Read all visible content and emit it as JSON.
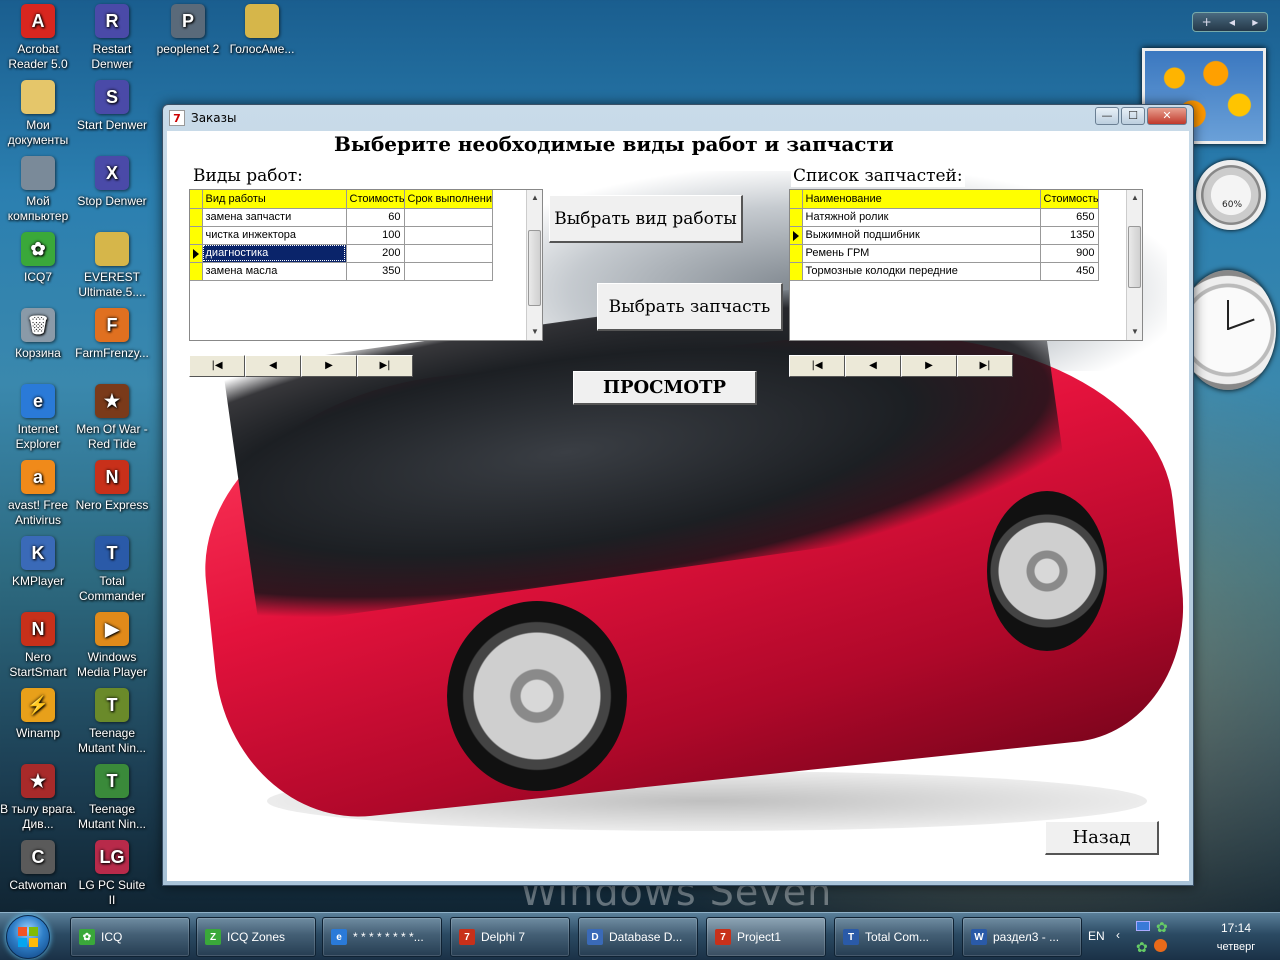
{
  "desktop": {
    "icons": [
      {
        "label": "Acrobat Reader 5.0",
        "color": "#d8261f",
        "glyph": "A"
      },
      {
        "label": "Restart Denwer",
        "color": "#4a4aa8",
        "glyph": "R"
      },
      {
        "label": "peoplenet 2",
        "color": "#5a6a7a",
        "glyph": "P"
      },
      {
        "label": "ГолосАме...",
        "color": "#d6b64a",
        "glyph": ""
      },
      {
        "label": "Мои документы",
        "color": "#e5c66a",
        "glyph": ""
      },
      {
        "label": "Start Denwer",
        "color": "#4a4aa8",
        "glyph": "S"
      },
      {
        "label": "Мой компьютер",
        "color": "#7a8a99",
        "glyph": ""
      },
      {
        "label": "Stop Denwer",
        "color": "#4a4aa8",
        "glyph": "X"
      },
      {
        "label": "ICQ7",
        "color": "#3aa83a",
        "glyph": "✿"
      },
      {
        "label": "EVEREST Ultimate.5....",
        "color": "#d6b64a",
        "glyph": ""
      },
      {
        "label": "Корзина",
        "color": "#8a9aa8",
        "glyph": "🗑"
      },
      {
        "label": "FarmFrenzy...",
        "color": "#e07020",
        "glyph": "F"
      },
      {
        "label": "Internet Explorer",
        "color": "#2a7ad8",
        "glyph": "e"
      },
      {
        "label": "Men Of War - Red Tide",
        "color": "#7a3a1a",
        "glyph": "★"
      },
      {
        "label": "avast! Free Antivirus",
        "color": "#f08a1a",
        "glyph": "a"
      },
      {
        "label": "Nero Express",
        "color": "#c8301a",
        "glyph": "N"
      },
      {
        "label": "KMPlayer",
        "color": "#3a6ab8",
        "glyph": "K"
      },
      {
        "label": "Total Commander",
        "color": "#2a5aa8",
        "glyph": "T"
      },
      {
        "label": "Nero StartSmart",
        "color": "#c8301a",
        "glyph": "N"
      },
      {
        "label": "Windows Media Player",
        "color": "#e08a1a",
        "glyph": "▶"
      },
      {
        "label": "Winamp",
        "color": "#e8a01a",
        "glyph": "⚡"
      },
      {
        "label": "Teenage Mutant Nin...",
        "color": "#6a8a2a",
        "glyph": "T"
      },
      {
        "label": "В тылу врага. Див...",
        "color": "#a82a2a",
        "glyph": "★"
      },
      {
        "label": "Teenage Mutant Nin...",
        "color": "#3a8a3a",
        "glyph": "T"
      },
      {
        "label": "Catwoman",
        "color": "#5a5a5a",
        "glyph": "C"
      },
      {
        "label": "LG PC Suite II",
        "color": "#b82a4a",
        "glyph": "LG"
      }
    ],
    "watermark": "Windows Seven"
  },
  "gadgets": {
    "cpu_label": "60%"
  },
  "window": {
    "title": "Заказы",
    "title_icon": "7",
    "btn_minimize": "—",
    "btn_maximize": "☐",
    "btn_close": "✕",
    "form_title": "Выберите необходимые виды работ и запчасти",
    "works": {
      "label": "Виды работ:",
      "columns": [
        "Вид работы",
        "Стоимость",
        "Срок выполнения"
      ],
      "rows": [
        {
          "name": "замена запчасти",
          "cost": "60",
          "term": ""
        },
        {
          "name": "чистка инжектора",
          "cost": "100",
          "term": ""
        },
        {
          "name": "диагностика",
          "cost": "200",
          "term": ""
        },
        {
          "name": "замена масла",
          "cost": "350",
          "term": ""
        }
      ],
      "selected_row": 2
    },
    "parts": {
      "label": "Список запчастей:",
      "columns": [
        "Наименование",
        "Стоимость"
      ],
      "rows": [
        {
          "name": "Натяжной ролик",
          "cost": "650"
        },
        {
          "name": "Выжимной подшибник",
          "cost": "1350"
        },
        {
          "name": "Ремень ГРМ",
          "cost": "900"
        },
        {
          "name": "Тормозные колодки передние",
          "cost": "450"
        }
      ],
      "selected_row": 1
    },
    "navigator": {
      "first": "|◀",
      "prior": "◀",
      "next": "▶",
      "last": "▶|"
    },
    "btn_select_work": "Выбрать вид работы",
    "btn_select_part": "Выбрать запчасть",
    "btn_view": "ПРОСМОТР",
    "btn_back": "Назад"
  },
  "taskbar": {
    "items": [
      {
        "label": "ICQ",
        "color": "#3aa83a",
        "glyph": "✿"
      },
      {
        "label": "ICQ Zones",
        "color": "#3aa83a",
        "glyph": "Z"
      },
      {
        "label": "* * * * * * * *...",
        "color": "#2a7ad8",
        "glyph": "e"
      },
      {
        "label": "Delphi 7",
        "color": "#c8301a",
        "glyph": "7"
      },
      {
        "label": "Database D...",
        "color": "#3a6ab8",
        "glyph": "D"
      },
      {
        "label": "Project1",
        "color": "#c8301a",
        "glyph": "7"
      },
      {
        "label": "Total Com...",
        "color": "#2a5aa8",
        "glyph": "T"
      },
      {
        "label": "раздел3 - ...",
        "color": "#2a5aa8",
        "glyph": "W"
      }
    ],
    "active_index": 5,
    "language": "EN",
    "time": "17:14",
    "day": "четверг"
  }
}
